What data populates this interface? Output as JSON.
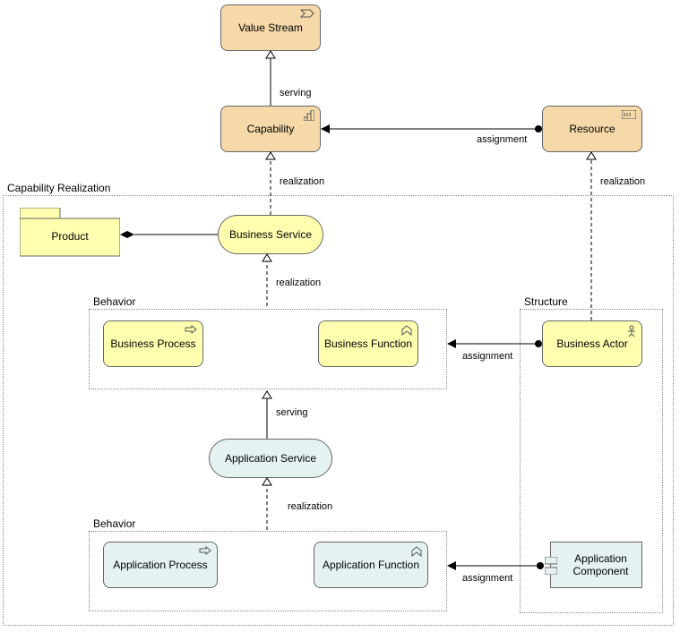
{
  "nodes": {
    "valueStream": "Value Stream",
    "capability": "Capability",
    "resource": "Resource",
    "product": "Product",
    "businessService": "Business Service",
    "businessProcess": "Business Process",
    "businessFunction": "Business Function",
    "businessActor": "Business Actor",
    "applicationService": "Application Service",
    "applicationProcess": "Application Process",
    "applicationFunction": "Application Function",
    "applicationComponent": "Application Component"
  },
  "groups": {
    "capabilityRealization": "Capability Realization",
    "behavior1": "Behavior",
    "behavior2": "Behavior",
    "structure": "Structure"
  },
  "labels": {
    "serving1": "serving",
    "realization1": "realization",
    "realization2": "realization",
    "realization3": "realization",
    "realization4": "realization",
    "assignment1": "assignment",
    "assignment2": "assignment",
    "assignment3": "assignment",
    "serving2": "serving"
  }
}
